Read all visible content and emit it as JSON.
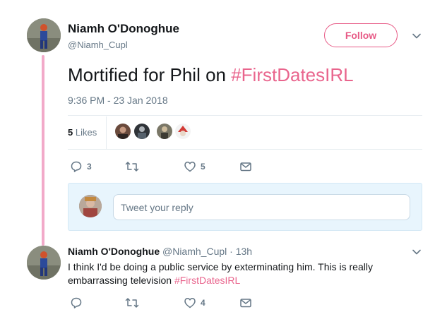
{
  "tweet": {
    "author_name": "Niamh O'Donoghue",
    "author_handle": "@Niamh_Cupl",
    "follow_label": "Follow",
    "text_before": "Mortified for Phil on ",
    "hashtag": "#FirstDatesIRL",
    "timestamp": "9:36 PM - 23 Jan 2018",
    "likes_number": "5",
    "likes_word": " Likes",
    "actions": {
      "replies": "3",
      "retweets": "",
      "likes": "5"
    },
    "likers_icons": [
      "liker-avatar-1",
      "liker-avatar-2",
      "liker-avatar-3",
      "liker-avatar-4"
    ]
  },
  "reply_composer": {
    "placeholder": "Tweet your reply"
  },
  "reply_tweet": {
    "author_name": "Niamh O'Donoghue",
    "author_handle": "@Niamh_Cupl",
    "separator": " · ",
    "time": "13h",
    "text": "I think I'd be doing a public service by exterminating him. This is really embarrassing television ",
    "hashtag": "#FirstDatesIRL",
    "actions": {
      "replies": "",
      "retweets": "",
      "likes": "4"
    }
  },
  "colors": {
    "accent_pink": "#e0245e",
    "thread_line": "#f2aac9",
    "secondary_text": "#657786",
    "reply_box_bg": "#e8f5fd"
  }
}
